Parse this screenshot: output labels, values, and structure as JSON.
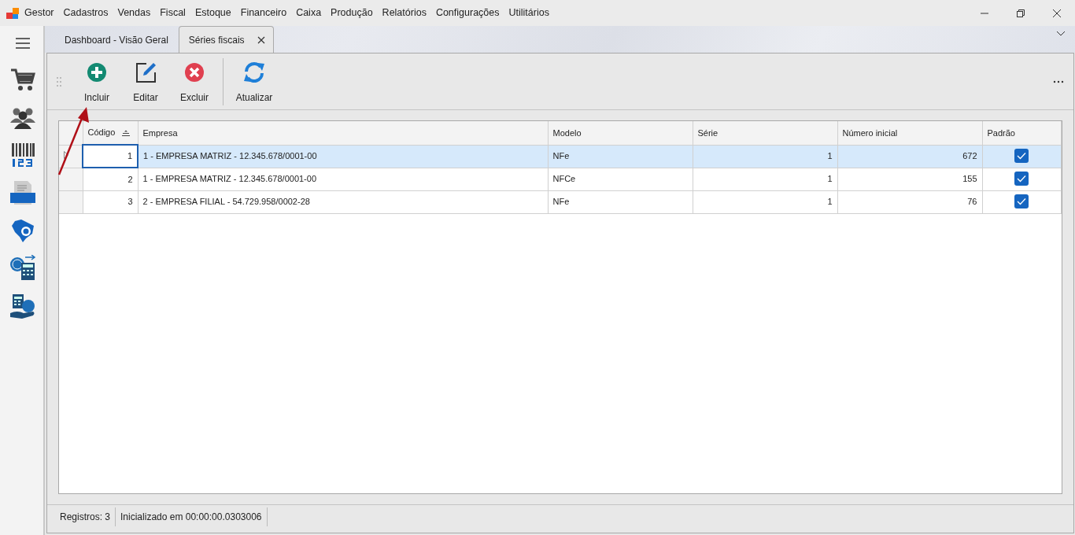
{
  "app": {
    "name": "Gestor"
  },
  "menu": [
    "Cadastros",
    "Vendas",
    "Fiscal",
    "Estoque",
    "Financeiro",
    "Caixa",
    "Produção",
    "Relatórios",
    "Configurações",
    "Utilitários"
  ],
  "tabs": [
    {
      "label": "Dashboard - Visão Geral",
      "selected": false,
      "closable": false
    },
    {
      "label": "Séries fiscais",
      "selected": true,
      "closable": true
    }
  ],
  "toolbar": [
    {
      "label": "Incluir",
      "kind": "add",
      "separator_before": false
    },
    {
      "label": "Editar",
      "kind": "edit",
      "separator_before": false
    },
    {
      "label": "Excluir",
      "kind": "delete",
      "separator_before": false
    },
    {
      "label": "Atualizar",
      "kind": "refresh",
      "separator_before": true
    }
  ],
  "table": {
    "columns": [
      {
        "label": "Código",
        "sorted": true
      },
      {
        "label": "Empresa",
        "sorted": false
      },
      {
        "label": "Modelo",
        "sorted": false
      },
      {
        "label": "Série",
        "sorted": false
      },
      {
        "label": "Número inicial",
        "sorted": false
      },
      {
        "label": "Padrão",
        "sorted": false
      }
    ],
    "rows": [
      {
        "selected": true,
        "cells": [
          "1",
          "1 - EMPRESA MATRIZ - 12.345.678/0001-00",
          "NFe",
          "1",
          "672"
        ],
        "padrao": true
      },
      {
        "selected": false,
        "cells": [
          "2",
          "1 - EMPRESA MATRIZ - 12.345.678/0001-00",
          "NFCe",
          "1",
          "155"
        ],
        "padrao": true
      },
      {
        "selected": false,
        "cells": [
          "3",
          "2 - EMPRESA FILIAL - 54.729.958/0002-28",
          "NFe",
          "1",
          "76"
        ],
        "padrao": true
      }
    ]
  },
  "status_bar": [
    "Registros: 3",
    "Inicializado em 00:00:00.0303006"
  ]
}
